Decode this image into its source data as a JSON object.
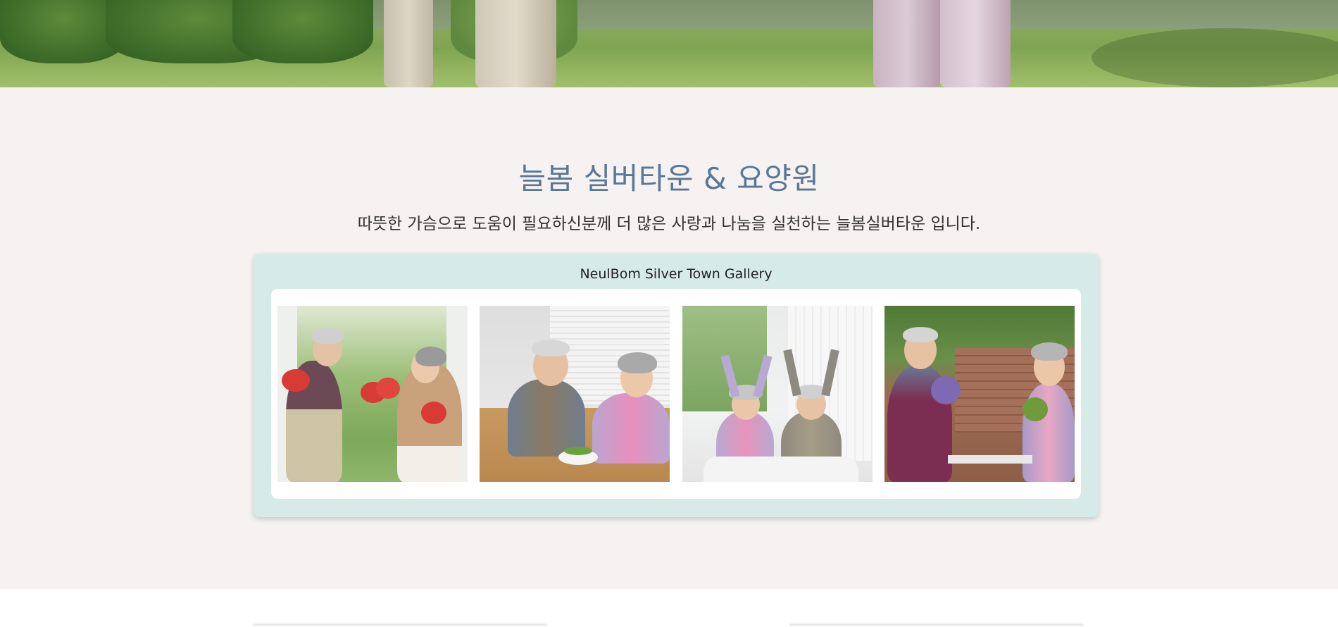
{
  "hero": {
    "description_icon": "garden-photo"
  },
  "intro": {
    "title": "늘봄 실버타운 & 요양원",
    "subtitle": "따뜻한 가슴으로 도움이 필요하신분께 더 많은 사랑과 나눔을 실천하는 늘봄실버타운 입니다."
  },
  "gallery": {
    "title": "NeulBom Silver Town Gallery",
    "photos": [
      {
        "icon": "boxing-couple-photo"
      },
      {
        "icon": "dining-couple-photo"
      },
      {
        "icon": "stretching-couple-photo"
      },
      {
        "icon": "gardening-couple-photo"
      }
    ]
  },
  "colors": {
    "section_bg": "#f5f2f1",
    "title": "#5b7796",
    "gallery_bg": "#d6ebe8"
  }
}
